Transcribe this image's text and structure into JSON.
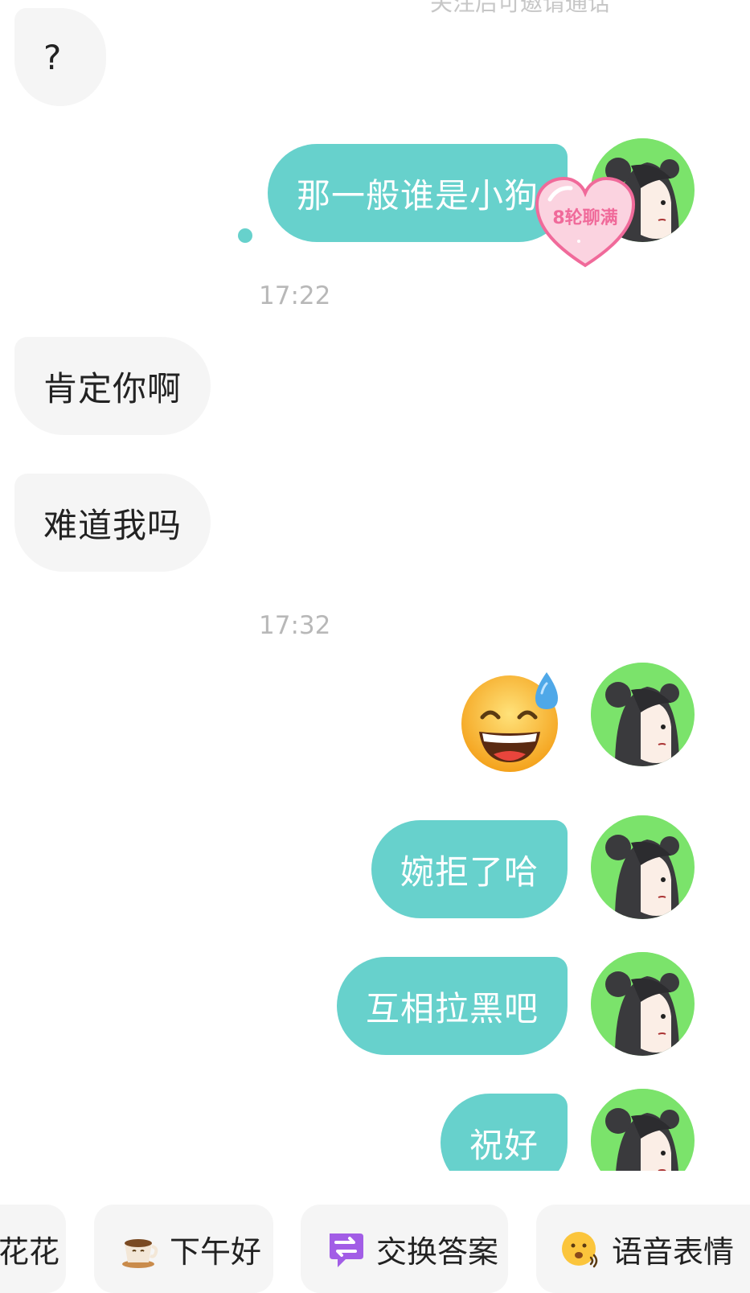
{
  "top_notice_clipped": "关注后可邀请通话",
  "messages": {
    "m1": "?",
    "m2": "那一般谁是小狗",
    "m3": "肯定你啊",
    "m4": "难道我吗",
    "m5_emoji": "😅",
    "m6": "婉拒了哈",
    "m7": "互相拉黑吧",
    "m8": "祝好"
  },
  "timestamps": {
    "t1": "17:22",
    "t2": "17:32"
  },
  "badge": {
    "label": "8轮聊满",
    "color": "#f06a9a"
  },
  "quick_replies": [
    {
      "label": "花花",
      "icon": "flower-icon"
    },
    {
      "label": "下午好",
      "icon": "coffee-cup-icon"
    },
    {
      "label": "交换答案",
      "icon": "exchange-icon"
    },
    {
      "label": "语音表情",
      "icon": "voice-emoji-icon"
    }
  ],
  "colors": {
    "self_bubble": "#67d1cc",
    "other_bubble": "#f5f5f5",
    "avatar_bg": "#7be36b",
    "timestamp": "#b8b8b8"
  }
}
